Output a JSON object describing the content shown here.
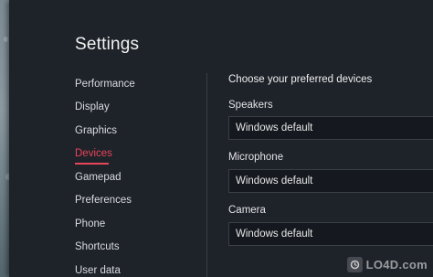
{
  "window": {
    "title": "Settings"
  },
  "sidebar": {
    "items": [
      {
        "label": "Performance",
        "active": false
      },
      {
        "label": "Display",
        "active": false
      },
      {
        "label": "Graphics",
        "active": false
      },
      {
        "label": "Devices",
        "active": true
      },
      {
        "label": "Gamepad",
        "active": false
      },
      {
        "label": "Preferences",
        "active": false
      },
      {
        "label": "Phone",
        "active": false
      },
      {
        "label": "Shortcuts",
        "active": false
      },
      {
        "label": "User data",
        "active": false
      }
    ]
  },
  "devices": {
    "heading": "Choose your preferred devices",
    "speakers": {
      "label": "Speakers",
      "value": "Windows default"
    },
    "microphone": {
      "label": "Microphone",
      "value": "Windows default"
    },
    "camera": {
      "label": "Camera",
      "value": "Windows default"
    }
  },
  "watermark": {
    "text": "LO4D.com"
  },
  "colors": {
    "accent": "#e8455a",
    "window_bg": "#1e2229",
    "field_bg": "#15181e"
  }
}
